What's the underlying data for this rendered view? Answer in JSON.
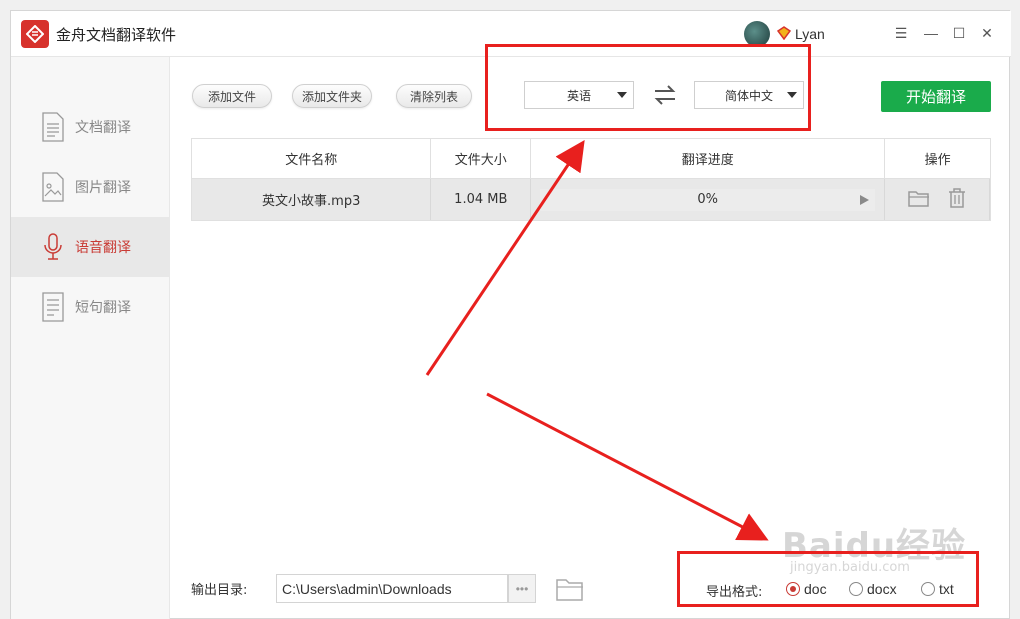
{
  "app": {
    "title": "金舟文档翻译软件",
    "user": "Lyan"
  },
  "window_controls": {
    "menu": "☰",
    "minimize": "—",
    "maximize": "☐",
    "close": "✕"
  },
  "sidebar": {
    "items": [
      {
        "label": "文档翻译",
        "icon": "document-icon",
        "active": false
      },
      {
        "label": "图片翻译",
        "icon": "image-icon",
        "active": false
      },
      {
        "label": "语音翻译",
        "icon": "microphone-icon",
        "active": true
      },
      {
        "label": "短句翻译",
        "icon": "text-icon",
        "active": false
      }
    ]
  },
  "toolbar": {
    "add_file": "添加文件",
    "add_folder": "添加文件夹",
    "clear_list": "清除列表",
    "source_lang": "英语",
    "target_lang": "简体中文",
    "start": "开始翻译"
  },
  "table": {
    "headers": [
      "文件名称",
      "文件大小",
      "翻译进度",
      "操作"
    ],
    "rows": [
      {
        "name": "英文小故事.mp3",
        "size": "1.04 MB",
        "progress": "0%"
      }
    ]
  },
  "output": {
    "label": "输出目录:",
    "path": "C:\\Users\\admin\\Downloads",
    "browse": "•••"
  },
  "export": {
    "label": "导出格式:",
    "options": [
      "doc",
      "docx",
      "txt"
    ],
    "selected": "doc"
  },
  "watermark": {
    "main": "Baidu经验",
    "sub": "jingyan.baidu.com"
  },
  "colors": {
    "accent": "#c93b35",
    "start_button": "#1aab4b",
    "annotation": "#e8201e"
  }
}
